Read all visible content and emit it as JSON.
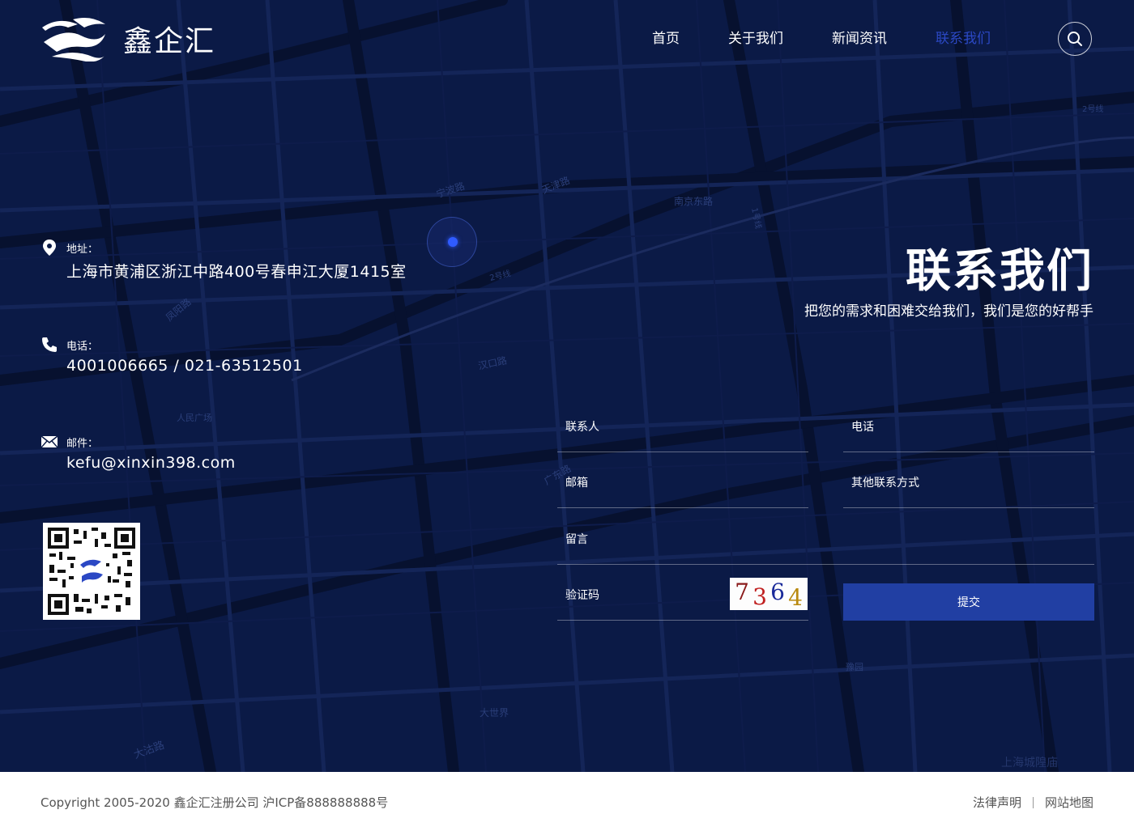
{
  "brand": {
    "name": "鑫企汇"
  },
  "nav": {
    "items": [
      {
        "label": "首页",
        "active": false
      },
      {
        "label": "关于我们",
        "active": false
      },
      {
        "label": "新闻资讯",
        "active": false
      },
      {
        "label": "联系我们",
        "active": true
      }
    ],
    "search_icon": "search-icon"
  },
  "map": {
    "labels": [
      "宁波路",
      "天津路",
      "南京东路",
      "2号线",
      "凤阳路",
      "汉口路",
      "人民广场",
      "广东路",
      "大世界",
      "豫园",
      "大沽路",
      "上海城隍庙",
      "1号线",
      "2号线"
    ]
  },
  "contact": {
    "address": {
      "label": "地址：",
      "value": "上海市黄浦区浙江中路400号春申江大厦1415室",
      "icon": "location-pin-icon"
    },
    "phone": {
      "label": "电话：",
      "value": "4001006665 / 021-63512501",
      "icon": "phone-icon"
    },
    "email": {
      "label": "邮件：",
      "value": "kefu@xinxin398.com",
      "icon": "mail-icon"
    }
  },
  "headline": {
    "title": "联系我们",
    "subtitle": "把您的需求和困难交给我们，我们是您的好帮手"
  },
  "form": {
    "contact_person_placeholder": "联系人",
    "phone_placeholder": "电话",
    "email_placeholder": "邮箱",
    "other_placeholder": "其他联系方式",
    "message_placeholder": "留言",
    "captcha_placeholder": "验证码",
    "captcha_digits": [
      "7",
      "3",
      "6",
      "4"
    ],
    "submit_label": "提交"
  },
  "footer": {
    "copyright": "Copyright 2005-2020 鑫企汇注册公司 沪ICP备888888888号",
    "links": [
      "法律声明",
      "网站地图"
    ]
  },
  "colors": {
    "background": "#0b1a46",
    "accent": "#213fa3",
    "nav_active": "#2b48c4",
    "marker": "#2f5bff"
  }
}
